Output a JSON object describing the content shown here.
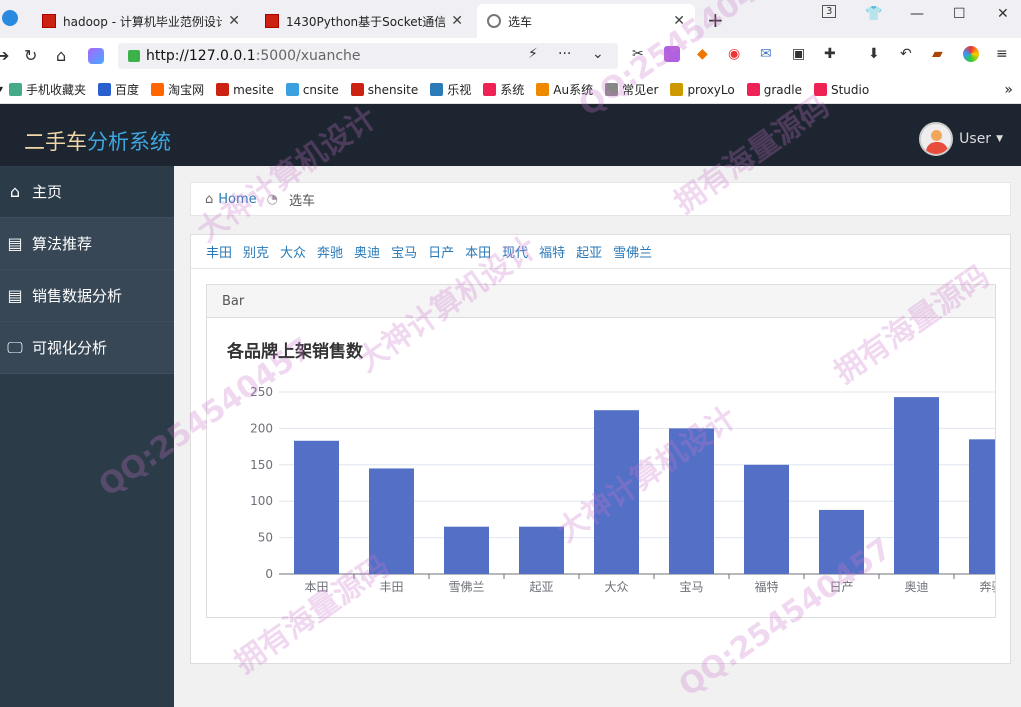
{
  "browser": {
    "tabs": [
      {
        "title": "hadoop - 计算机毕业范例设计"
      },
      {
        "title": "1430Python基于Socket通信"
      },
      {
        "title": "选车"
      }
    ],
    "address": {
      "host": "http://127.0.0.1",
      "path": ":5000/xuanche"
    },
    "tab_count_badge": "3",
    "bookmarks": [
      {
        "label": "手机收藏夹",
        "color": "#4a8"
      },
      {
        "label": "百度",
        "color": "#2a5fd0"
      },
      {
        "label": "淘宝网",
        "color": "#f60"
      },
      {
        "label": "mesite",
        "color": "#c21"
      },
      {
        "label": "cnsite",
        "color": "#3aa0e0"
      },
      {
        "label": "shensite",
        "color": "#c21"
      },
      {
        "label": "乐视",
        "color": "#2a7ab8"
      },
      {
        "label": "系统",
        "color": "#e25"
      },
      {
        "label": "Au系统",
        "color": "#e80"
      },
      {
        "label": "常见er",
        "color": "#888"
      },
      {
        "label": "proxyLo",
        "color": "#c90"
      },
      {
        "label": "gradle",
        "color": "#e25"
      },
      {
        "label": "Studio",
        "color": "#e25"
      }
    ]
  },
  "app": {
    "brand_part1": "二手车",
    "brand_part2": "分析系统",
    "user_label": "User",
    "sidebar": [
      {
        "label": "主页",
        "icon": "home-icon"
      },
      {
        "label": "算法推荐",
        "icon": "document-icon"
      },
      {
        "label": "销售数据分析",
        "icon": "document-icon"
      },
      {
        "label": "可视化分析",
        "icon": "monitor-icon"
      }
    ],
    "breadcrumb": {
      "home": "Home",
      "current": "选车"
    },
    "brand_filters": [
      "丰田",
      "别克",
      "大众",
      "奔驰",
      "奥迪",
      "宝马",
      "日产",
      "本田",
      "现代",
      "福特",
      "起亚",
      "雪佛兰"
    ],
    "panel_heading": "Bar",
    "watermarks": [
      "QQ:254540457",
      "大神计算机设计",
      "拥有海量源码"
    ]
  },
  "chart_data": {
    "type": "bar",
    "title": "各品牌上架销售数",
    "categories": [
      "本田",
      "丰田",
      "雪佛兰",
      "起亚",
      "大众",
      "宝马",
      "福特",
      "日产",
      "奥迪",
      "奔驰"
    ],
    "values": [
      183,
      145,
      65,
      65,
      225,
      200,
      150,
      88,
      243,
      185
    ],
    "ylim": [
      0,
      250
    ],
    "yticks": [
      0,
      50,
      100,
      150,
      200,
      250
    ],
    "color": "#5470c6",
    "grid": true
  }
}
